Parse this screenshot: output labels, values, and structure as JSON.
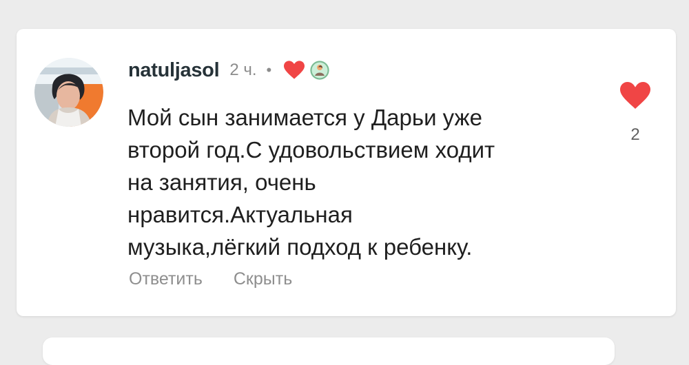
{
  "comment": {
    "username": "natuljasol",
    "time": "2 ч.",
    "separator": "•",
    "text": "Мой сын занимается у Дарьи уже\nвторой год.С удовольствием ходит\nна занятия, очень\nнравится.Актуальная\nмузыка,лёгкий подход к ребенку.",
    "like_count": "2",
    "actions": {
      "reply": "Ответить",
      "hide": "Скрыть"
    }
  },
  "colors": {
    "accent_heart": "#f04545",
    "text": "#1f1f1f",
    "muted": "#8e8e8e",
    "background": "#ececec",
    "card": "#ffffff"
  },
  "icons": {
    "author_like": "heart-icon",
    "like": "heart-icon",
    "avatar": "user-avatar",
    "mini_avatar": "author-avatar"
  }
}
